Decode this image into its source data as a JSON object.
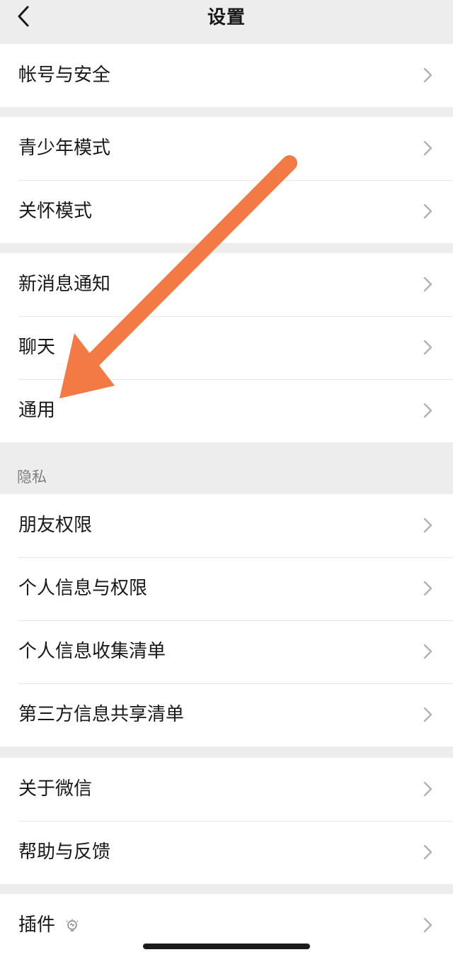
{
  "header": {
    "title": "设置",
    "back_icon": "chevron-left-icon"
  },
  "groups": {
    "account": {
      "items": [
        {
          "label": "帐号与安全"
        }
      ]
    },
    "modes": {
      "items": [
        {
          "label": "青少年模式"
        },
        {
          "label": "关怀模式"
        }
      ]
    },
    "general": {
      "items": [
        {
          "label": "新消息通知"
        },
        {
          "label": "聊天"
        },
        {
          "label": "通用"
        }
      ]
    },
    "privacy": {
      "section_title": "隐私",
      "items": [
        {
          "label": "朋友权限"
        },
        {
          "label": "个人信息与权限"
        },
        {
          "label": "个人信息收集清单"
        },
        {
          "label": "第三方信息共享清单"
        }
      ]
    },
    "about": {
      "items": [
        {
          "label": "关于微信"
        },
        {
          "label": "帮助与反馈"
        }
      ]
    },
    "plugins": {
      "items": [
        {
          "label": "插件",
          "icon": "lightbulb-icon"
        }
      ]
    }
  },
  "colors": {
    "background": "#ededed",
    "card": "#ffffff",
    "text": "#191919",
    "section_text": "#7f7f7f",
    "chevron": "#b2b2b2",
    "annotation_arrow": "#f47a45"
  }
}
